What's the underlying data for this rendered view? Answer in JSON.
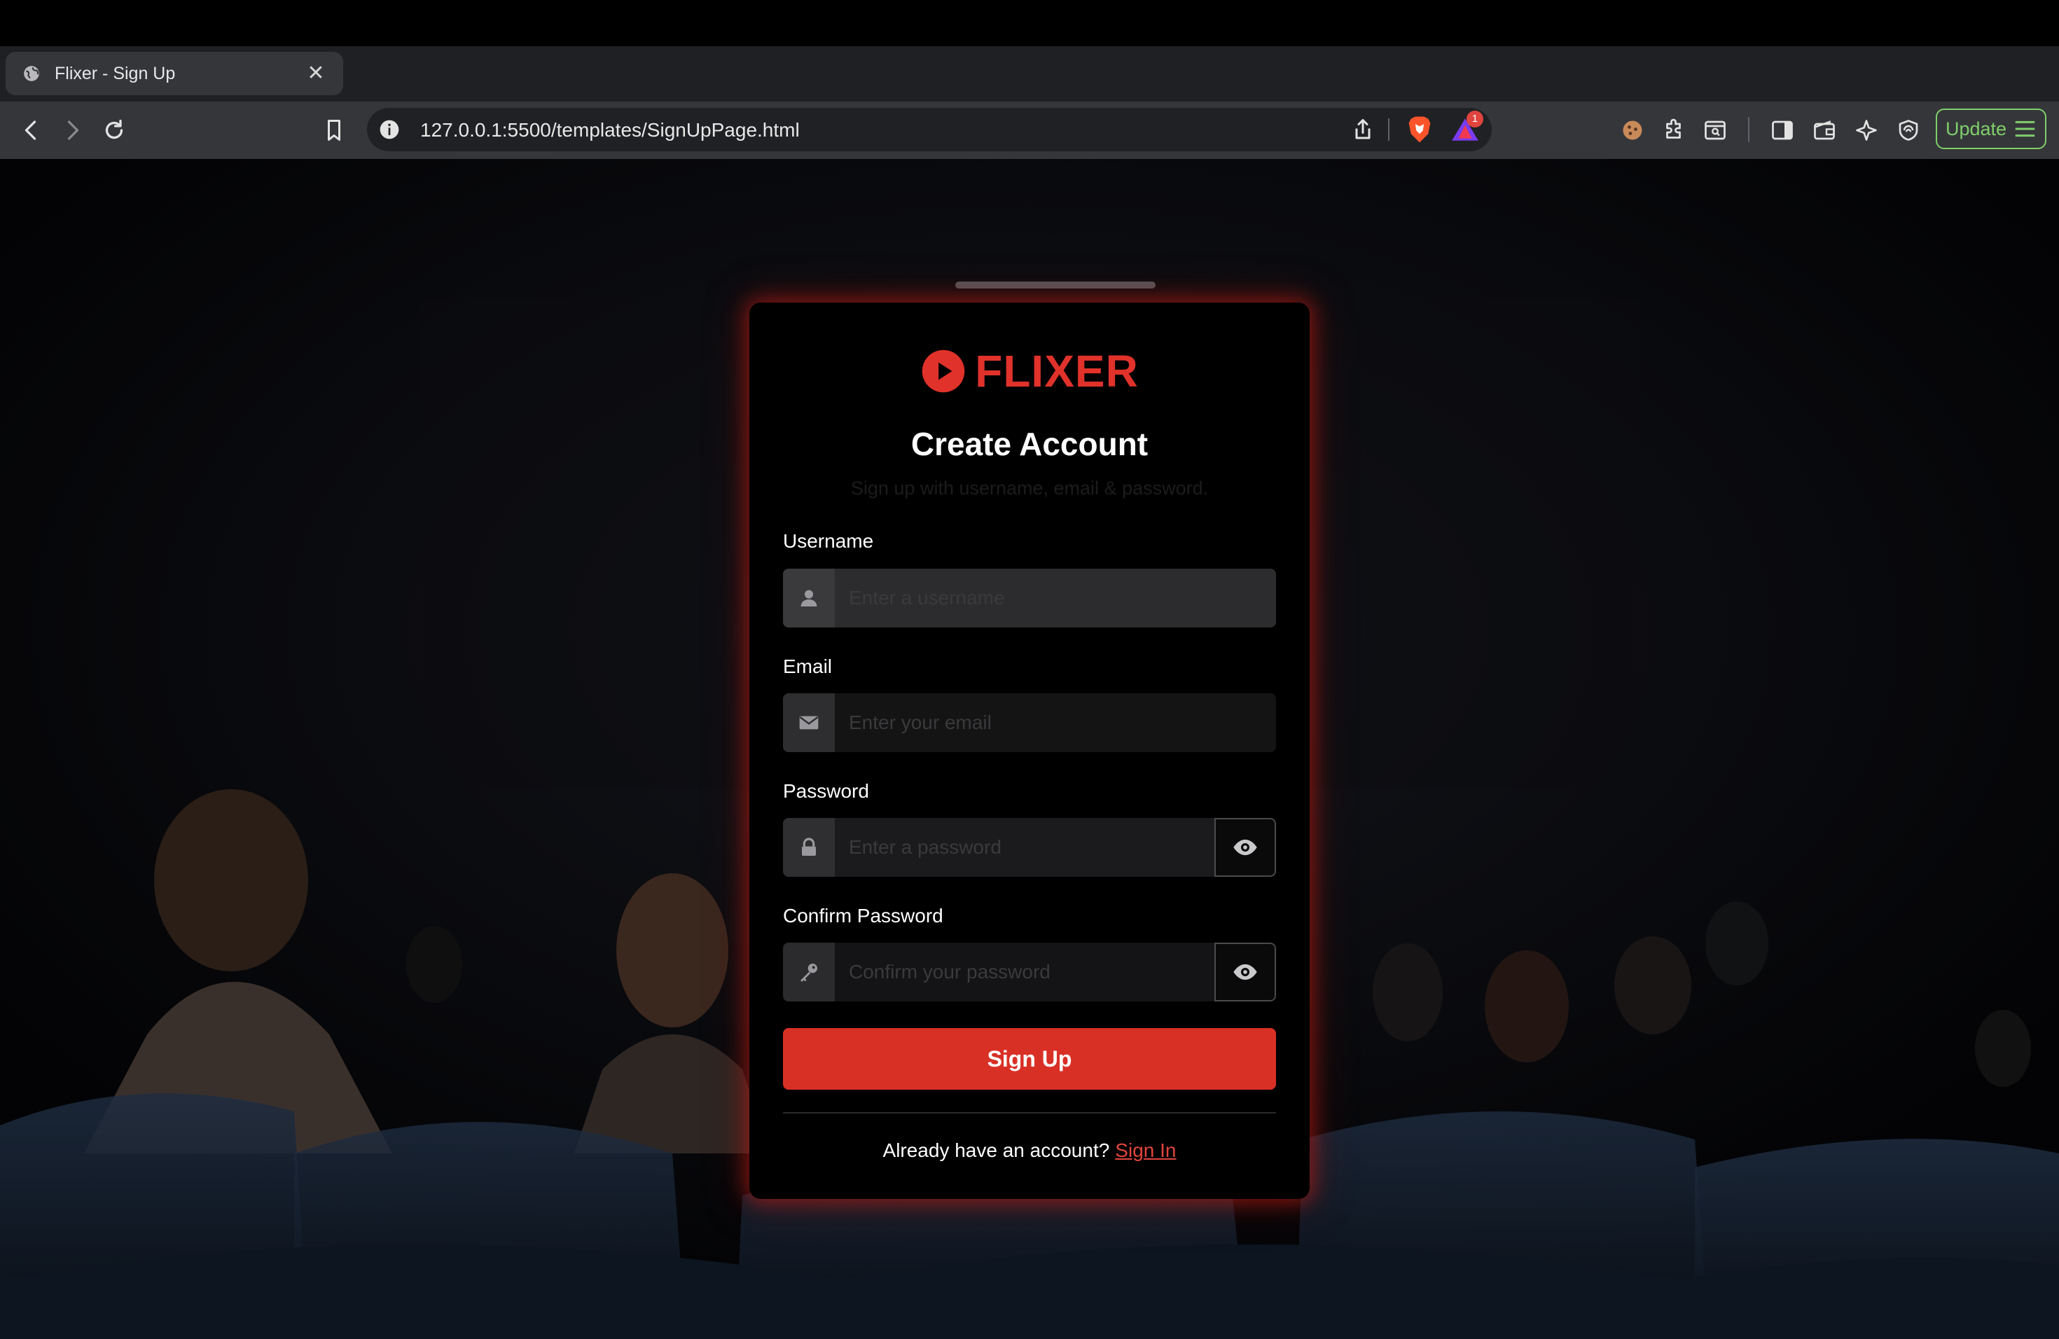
{
  "browser": {
    "tab_title": "Flixer - Sign Up",
    "url": "127.0.0.1:5500/templates/SignUpPage.html",
    "rewards_badge": "1",
    "update_label": "Update",
    "icons": [
      "back-icon",
      "forward-icon",
      "reload-icon",
      "bookmark-icon",
      "info-icon",
      "share-icon",
      "brave-shields-icon",
      "brave-rewards-icon",
      "cookie-icon",
      "extensions-icon",
      "page-search-icon",
      "sidebar-icon",
      "wallet-icon",
      "leo-ai-icon",
      "vpn-icon",
      "menu-icon"
    ]
  },
  "colors": {
    "brand_red": "#e0322a",
    "button_red": "#d93026",
    "link_red": "#e0453c",
    "update_green": "#7fcf6a"
  },
  "signup": {
    "brand": "FLIXER",
    "title": "Create Account",
    "subtitle": "Sign up with username, email & password.",
    "username": {
      "label": "Username",
      "placeholder": "Enter a username",
      "value": ""
    },
    "email": {
      "label": "Email",
      "placeholder": "Enter your email",
      "value": ""
    },
    "password": {
      "label": "Password",
      "placeholder": "Enter a password",
      "value": ""
    },
    "confirm_password": {
      "label": "Confirm Password",
      "placeholder": "Confirm your password",
      "value": ""
    },
    "submit_label": "Sign Up",
    "footer_text": "Already have an account?",
    "footer_link": "Sign In"
  }
}
